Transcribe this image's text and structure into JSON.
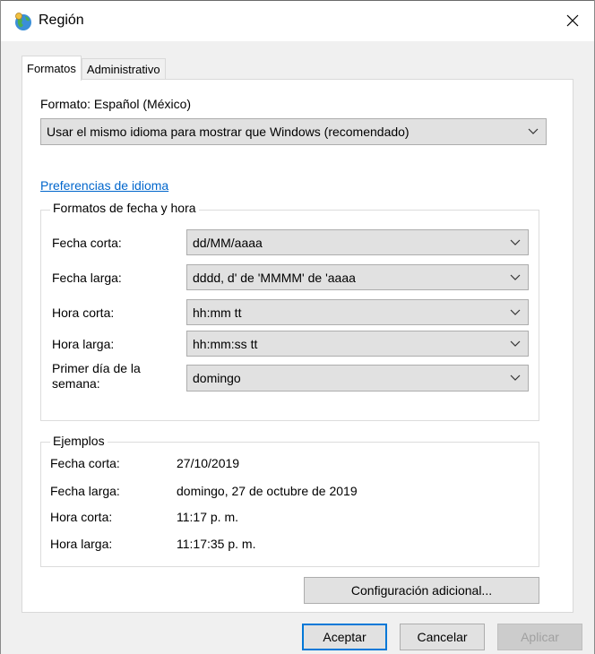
{
  "window": {
    "title": "Región"
  },
  "tabs": [
    {
      "label": "Formatos",
      "active": true
    },
    {
      "label": "Administrativo",
      "active": false
    }
  ],
  "format": {
    "label": "Formato: Español (México)",
    "selected": "Usar el mismo idioma para mostrar que Windows (recomendado)"
  },
  "language_link": "Preferencias de idioma",
  "date_time_formats": {
    "title": "Formatos de fecha y hora",
    "rows": [
      {
        "label": "Fecha corta:",
        "value": "dd/MM/aaaa"
      },
      {
        "label": "Fecha larga:",
        "value": "dddd, d' de 'MMMM' de 'aaaa"
      },
      {
        "label": "Hora corta:",
        "value": "hh:mm tt"
      },
      {
        "label": "Hora larga:",
        "value": "hh:mm:ss tt"
      },
      {
        "label": "Primer día de la semana:",
        "value": "domingo"
      }
    ]
  },
  "examples": {
    "title": "Ejemplos",
    "rows": [
      {
        "label": "Fecha corta:",
        "value": "27/10/2019"
      },
      {
        "label": "Fecha larga:",
        "value": "domingo, 27 de octubre de 2019"
      },
      {
        "label": "Hora corta:",
        "value": "11:17 p. m."
      },
      {
        "label": "Hora larga:",
        "value": "11:17:35 p. m."
      }
    ]
  },
  "buttons": {
    "additional": "Configuración adicional...",
    "ok": "Aceptar",
    "cancel": "Cancelar",
    "apply": "Aplicar"
  },
  "icons": {
    "app": "globe-region-icon",
    "close": "close-icon",
    "dropdown": "chevron-down-icon"
  },
  "colors": {
    "link": "#0066cc",
    "default_button_border": "#0078d7"
  }
}
